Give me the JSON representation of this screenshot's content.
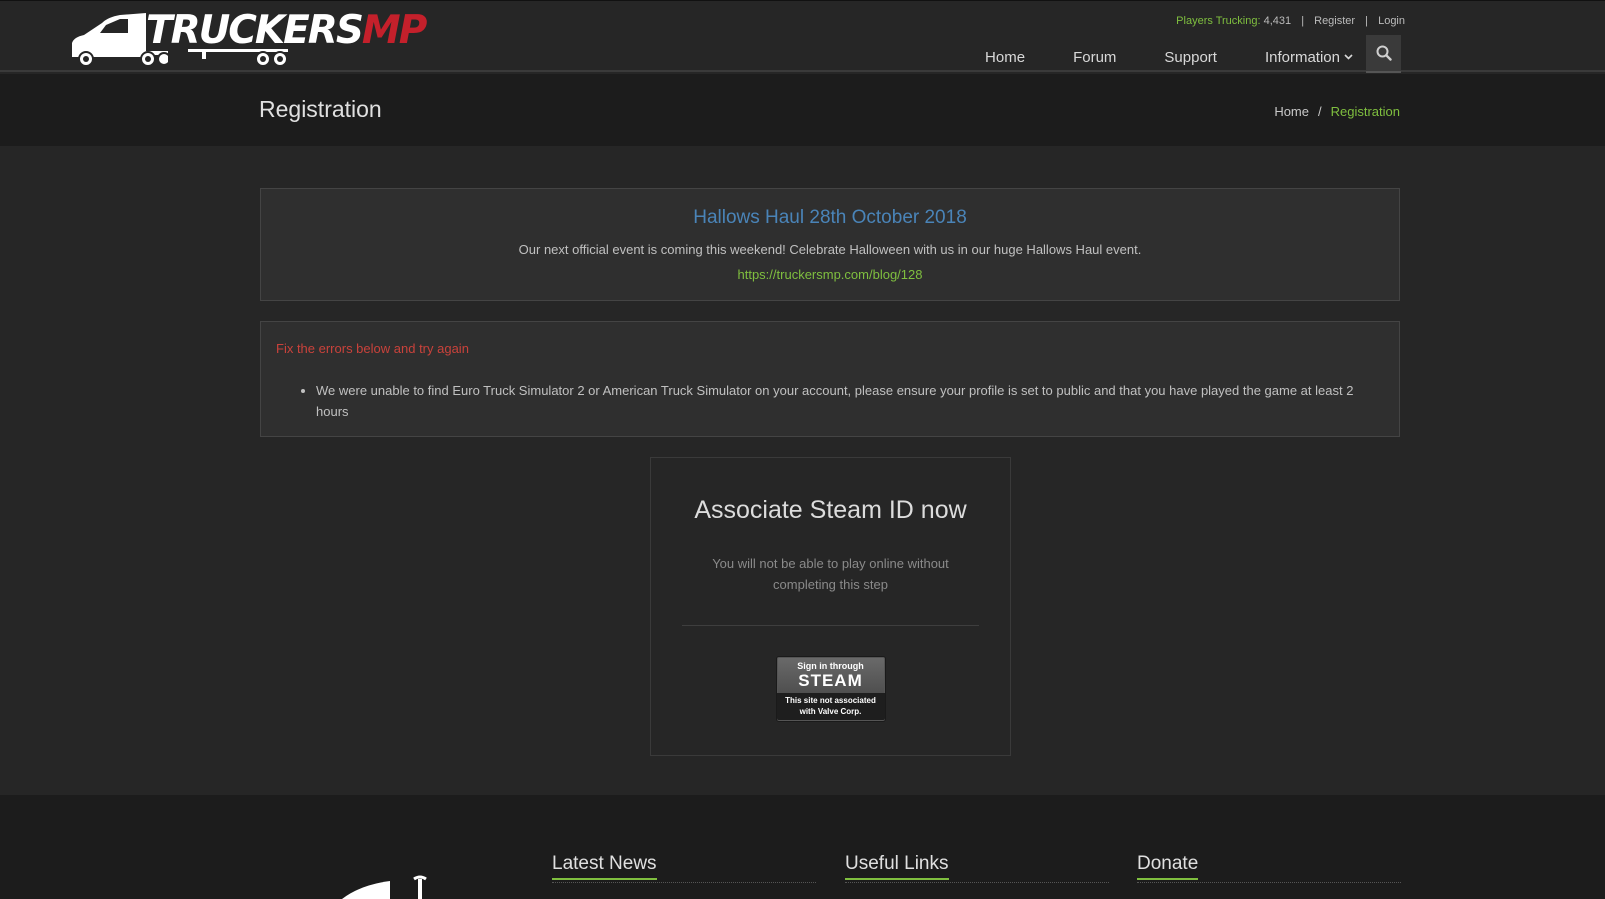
{
  "header": {
    "logo": {
      "text_white": "TRUCKERS",
      "text_red": "MP",
      "icon": "truck-logo-icon"
    },
    "top_links": {
      "players_label": "Players Trucking:",
      "players_count": "4,431",
      "separator": "|",
      "register": "Register",
      "login": "Login"
    },
    "nav": [
      {
        "label": "Home"
      },
      {
        "label": "Forum"
      },
      {
        "label": "Support"
      },
      {
        "label": "Information",
        "dropdown": true
      }
    ],
    "search_icon": "search-icon"
  },
  "title_bar": {
    "title": "Registration",
    "breadcrumb": {
      "home": "Home",
      "separator": "/",
      "current": "Registration"
    }
  },
  "notice": {
    "title": "Hallows Haul 28th October 2018",
    "text": "Our next official event is coming this weekend! Celebrate Halloween with us in our huge Hallows Haul event.",
    "link": "https://truckersmp.com/blog/128"
  },
  "error": {
    "title": "Fix the errors below and try again",
    "items": [
      "We were unable to find Euro Truck Simulator 2 or American Truck Simulator on your account, please ensure your profile is set to public and that you have played the game at least 2 hours"
    ]
  },
  "steam": {
    "title": "Associate Steam ID now",
    "subtitle": "You will not be able to play online without completing this step",
    "button": {
      "line1": "Sign in through",
      "line2": "STEAM",
      "line3a": "This site not associated",
      "line3b": "with Valve Corp."
    }
  },
  "footer": {
    "columns": [
      {
        "title": "Latest News"
      },
      {
        "title": "Useful Links"
      },
      {
        "title": "Donate"
      }
    ]
  },
  "colors": {
    "accent_green": "#7fbf3f",
    "brand_red": "#c4202b",
    "error_red": "#c9423b",
    "notice_blue": "#4a84b8"
  }
}
